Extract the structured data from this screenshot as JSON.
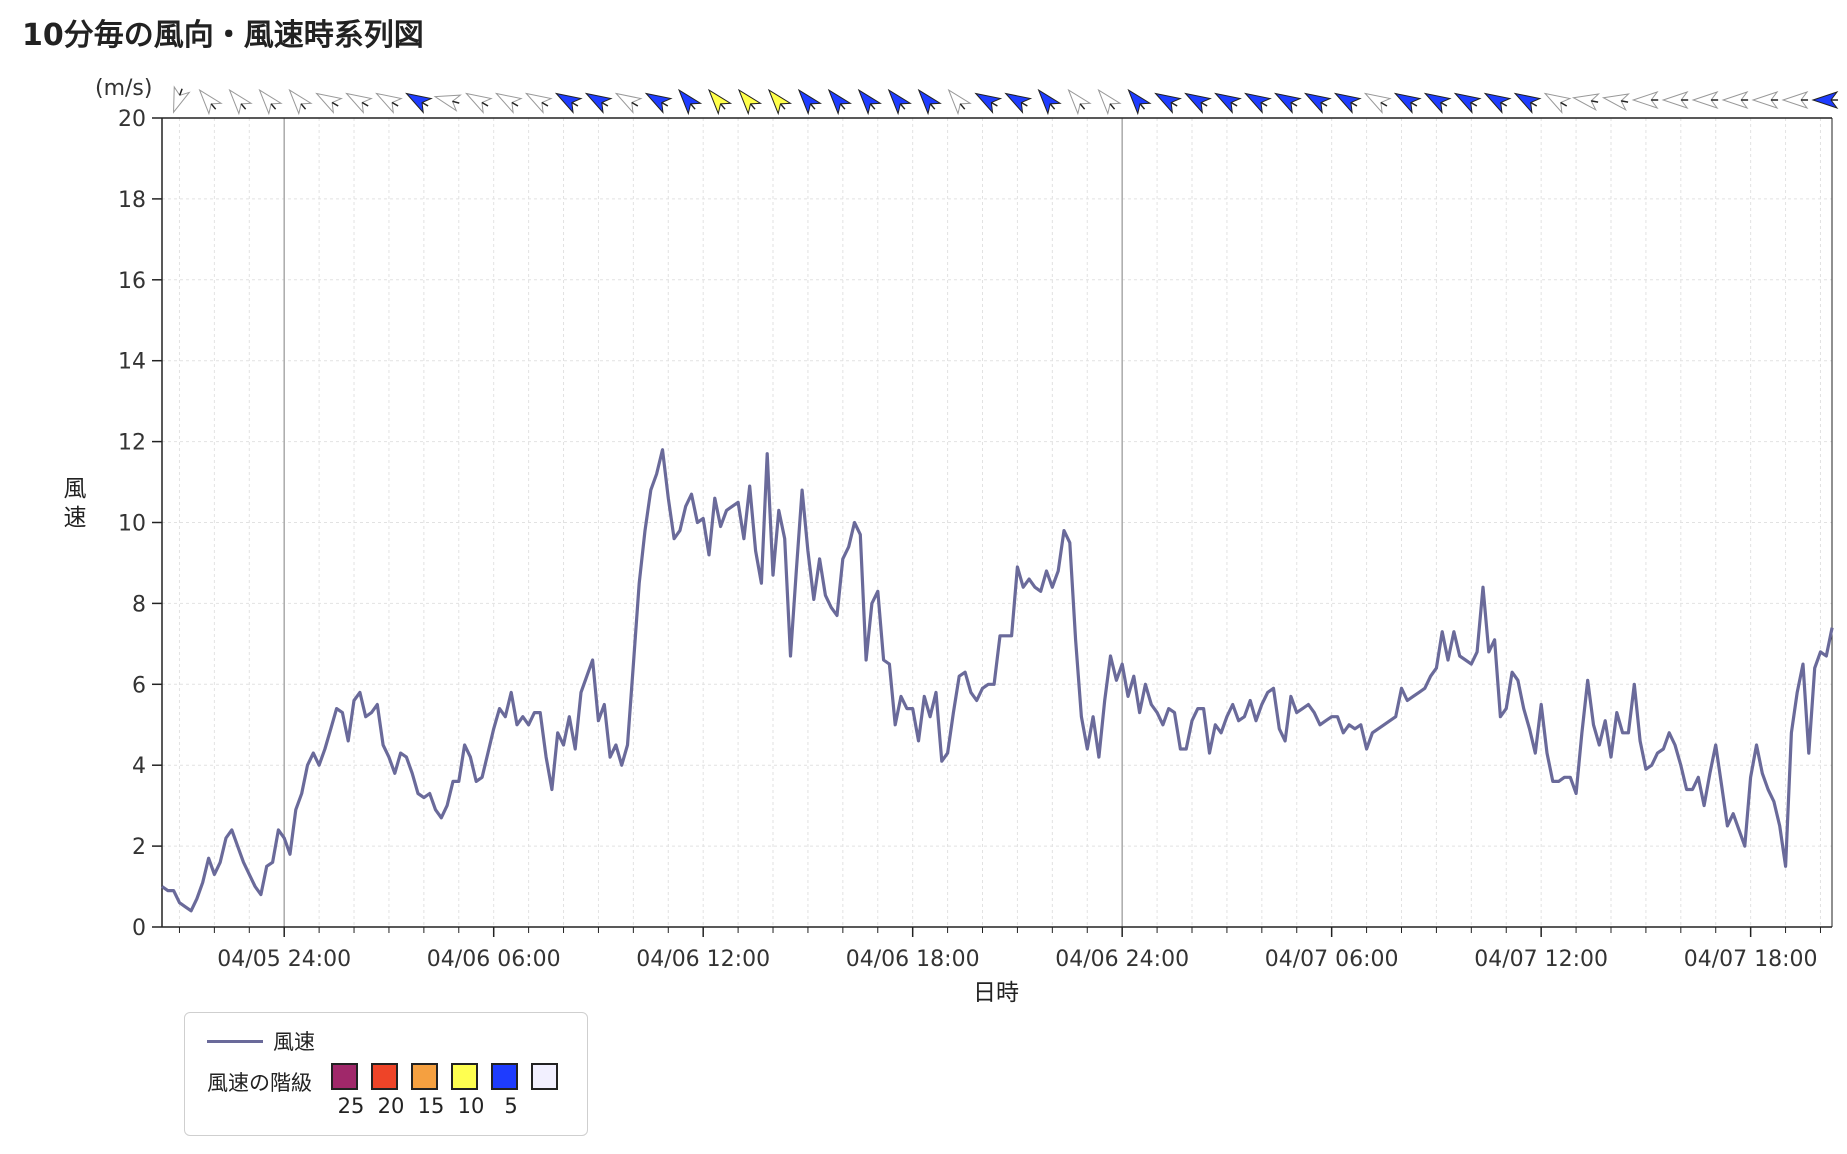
{
  "page": {
    "title": "10分毎の風向・風速時系列図"
  },
  "chart_data": {
    "type": "line",
    "unit_label": "(m/s)",
    "ylabel": "風速",
    "xlabel": "日時",
    "ylim": [
      0,
      20
    ],
    "yticks": [
      0,
      2,
      4,
      6,
      8,
      10,
      12,
      14,
      16,
      18,
      20
    ],
    "grid": true,
    "x_tick_labels": [
      "04/05 24:00",
      "04/06 06:00",
      "04/06 12:00",
      "04/06 18:00",
      "04/06 24:00",
      "04/07 06:00",
      "04/07 12:00",
      "04/07 18:00"
    ],
    "x_range_hours": [
      -3.5,
      44.33
    ],
    "sample_interval_minutes": 10,
    "series": [
      {
        "name": "風速",
        "color": "#6a6a9a",
        "values": [
          1.0,
          0.9,
          0.9,
          0.6,
          0.5,
          0.4,
          0.7,
          1.1,
          1.7,
          1.3,
          1.6,
          2.2,
          2.4,
          2.0,
          1.6,
          1.3,
          1.0,
          0.8,
          1.5,
          1.6,
          2.4,
          2.2,
          1.8,
          2.9,
          3.3,
          4.0,
          4.3,
          4.0,
          4.4,
          4.9,
          5.4,
          5.3,
          4.6,
          5.6,
          5.8,
          5.2,
          5.3,
          5.5,
          4.5,
          4.2,
          3.8,
          4.3,
          4.2,
          3.8,
          3.3,
          3.2,
          3.3,
          2.9,
          2.7,
          3.0,
          3.6,
          3.6,
          4.5,
          4.2,
          3.6,
          3.7,
          4.3,
          4.9,
          5.4,
          5.2,
          5.8,
          5.0,
          5.2,
          5.0,
          5.3,
          5.3,
          4.2,
          3.4,
          4.8,
          4.5,
          5.2,
          4.4,
          5.8,
          6.2,
          6.6,
          5.1,
          5.5,
          4.2,
          4.5,
          4.0,
          4.5,
          6.5,
          8.5,
          9.8,
          10.8,
          11.2,
          11.8,
          10.6,
          9.6,
          9.8,
          10.4,
          10.7,
          10.0,
          10.1,
          9.2,
          10.6,
          9.9,
          10.3,
          10.4,
          10.5,
          9.6,
          10.9,
          9.3,
          8.5,
          11.7,
          8.7,
          10.3,
          9.6,
          6.7,
          8.8,
          10.8,
          9.3,
          8.1,
          9.1,
          8.2,
          7.9,
          7.7,
          9.1,
          9.4,
          10.0,
          9.7,
          6.6,
          8.0,
          8.3,
          6.6,
          6.5,
          5.0,
          5.7,
          5.4,
          5.4,
          4.6,
          5.7,
          5.2,
          5.8,
          4.1,
          4.3,
          5.3,
          6.2,
          6.3,
          5.8,
          5.6,
          5.9,
          6.0,
          6.0,
          7.2,
          7.2,
          7.2,
          8.9,
          8.4,
          8.6,
          8.4,
          8.3,
          8.8,
          8.4,
          8.8,
          9.8,
          9.5,
          7.1,
          5.2,
          4.4,
          5.2,
          4.2,
          5.6,
          6.7,
          6.1,
          6.5,
          5.7,
          6.2,
          5.3,
          6.0,
          5.5,
          5.3,
          5.0,
          5.4,
          5.3,
          4.4,
          4.4,
          5.1,
          5.4,
          5.4,
          4.3,
          5.0,
          4.8,
          5.2,
          5.5,
          5.1,
          5.2,
          5.6,
          5.1,
          5.5,
          5.8,
          5.9,
          4.9,
          4.6,
          5.7,
          5.3,
          5.4,
          5.5,
          5.3,
          5.0,
          5.1,
          5.2,
          5.2,
          4.8,
          5.0,
          4.9,
          5.0,
          4.4,
          4.8,
          4.9,
          5.0,
          5.1,
          5.2,
          5.9,
          5.6,
          5.7,
          5.8,
          5.9,
          6.2,
          6.4,
          7.3,
          6.6,
          7.3,
          6.7,
          6.6,
          6.5,
          6.8,
          8.4,
          6.8,
          7.1,
          5.2,
          5.4,
          6.3,
          6.1,
          5.4,
          4.9,
          4.3,
          5.5,
          4.3,
          3.6,
          3.6,
          3.7,
          3.7,
          3.3,
          4.8,
          6.1,
          5.0,
          4.5,
          5.1,
          4.2,
          5.3,
          4.8,
          4.8,
          6.0,
          4.6,
          3.9,
          4.0,
          4.3,
          4.4,
          4.8,
          4.5,
          4.0,
          3.4,
          3.4,
          3.7,
          3.0,
          3.8,
          4.5,
          3.5,
          2.5,
          2.8,
          2.4,
          2.0,
          3.7,
          4.5,
          3.8,
          3.4,
          3.1,
          2.5,
          1.5,
          4.8,
          5.8,
          6.5,
          4.3,
          6.4,
          6.8,
          6.7,
          7.4
        ]
      }
    ],
    "wind_direction_strip": {
      "count": 48,
      "class_colors": [
        "#ffffff",
        "#1e3cff",
        "#ffff4a"
      ],
      "classes": [
        0,
        0,
        0,
        0,
        0,
        0,
        0,
        0,
        1,
        0,
        0,
        0,
        0,
        1,
        1,
        0,
        1,
        1,
        2,
        2,
        2,
        1,
        1,
        1,
        1,
        1,
        0,
        1,
        1,
        1,
        0,
        0,
        1,
        1,
        1,
        1,
        1,
        1,
        1,
        1,
        0,
        1,
        1,
        1,
        1,
        1,
        0,
        0,
        0,
        0,
        0,
        0,
        0,
        0,
        0,
        1
      ],
      "angles": [
        200,
        320,
        320,
        320,
        320,
        300,
        300,
        300,
        300,
        285,
        300,
        300,
        300,
        300,
        300,
        300,
        300,
        320,
        320,
        320,
        320,
        320,
        320,
        320,
        320,
        320,
        320,
        300,
        300,
        320,
        320,
        320,
        320,
        300,
        300,
        300,
        300,
        300,
        300,
        300,
        300,
        300,
        300,
        300,
        300,
        300,
        300,
        280,
        280,
        270,
        270,
        270,
        270,
        270,
        270,
        270,
        330
      ]
    },
    "legend": {
      "line_label": "風速",
      "class_label": "風速の階級",
      "classes": [
        {
          "color": "#a0286a",
          "label": "25"
        },
        {
          "color": "#ee4428",
          "label": "20"
        },
        {
          "color": "#f5a040",
          "label": "15"
        },
        {
          "color": "#ffff50",
          "label": "10"
        },
        {
          "color": "#1e3cff",
          "label": "5"
        },
        {
          "color": "#f2f0ff",
          "label": ""
        }
      ],
      "position": "bottom-left"
    }
  }
}
